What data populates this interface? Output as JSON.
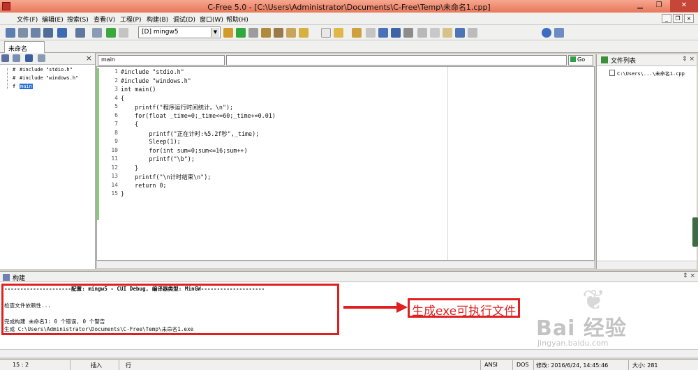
{
  "window": {
    "title": "C-Free 5.0 - [C:\\Users\\Administrator\\Documents\\C-Free\\Temp\\未命名1.cpp]",
    "controls": {
      "minimize": "▁",
      "maximize": "❐",
      "close": "✕"
    }
  },
  "menubar": {
    "items": [
      "文件(F)",
      "编辑(E)",
      "搜索(S)",
      "查看(V)",
      "工程(P)",
      "构建(B)",
      "调试(D)",
      "窗口(W)",
      "帮助(H)"
    ],
    "mdi_controls": {
      "minimize": "_",
      "restore": "❐",
      "close": "×"
    }
  },
  "toolbar": {
    "configuration": "[D] mingw5",
    "icons": [
      "find-icon",
      "replace-icon",
      "find-in-files-icon",
      "bookmark-icon",
      "tools-icon",
      "code-icon",
      "back-icon",
      "forward-icon",
      "compile-icon",
      "run-icon",
      "stop-icon",
      "build-icon",
      "rebuild-icon",
      "debug-icon",
      "new-file-icon",
      "open-file-icon",
      "open-project-icon",
      "save-icon",
      "save-all-icon",
      "print-icon",
      "cut-icon",
      "copy-icon",
      "paste-icon",
      "undo-icon",
      "redo-icon",
      "help-icon"
    ]
  },
  "tabs": [
    {
      "label": "未命名1.cpp",
      "active": true
    }
  ],
  "symbol_panel": {
    "close": "×",
    "items": [
      {
        "icon": "#",
        "label": "#include \"stdio.h\""
      },
      {
        "icon": "#",
        "label": "#include \"windows.h\""
      },
      {
        "icon": "f",
        "label": "main",
        "selected": true
      }
    ]
  },
  "editor": {
    "symbol_select": "main",
    "go_label": "Go",
    "lines": [
      "#include \"stdio.h\"",
      "#include \"windows.h\"",
      "int main()",
      "{",
      "    printf(\"程序运行时间统计。\\n\");",
      "    for(float _time=0;_time<=60;_time+=0.01)",
      "    {",
      "        printf(\"正在计时:%5.2f秒\",_time);",
      "        Sleep(1);",
      "        for(int sum=0;sum<=16;sum++)",
      "        printf(\"\\b\");",
      "    }",
      "    printf(\"\\n计时结束\\n\");",
      "    return 0;",
      "}"
    ],
    "line_numbers": [
      "1",
      "2",
      "3",
      "4",
      "5",
      "6",
      "7",
      "8",
      "9",
      "10",
      "11",
      "12",
      "13",
      "14",
      "15"
    ]
  },
  "file_list": {
    "title": "文件列表",
    "pins": "⇕ ×",
    "files": [
      "C:\\Users\\...\\未命名1.cpp"
    ]
  },
  "build_panel": {
    "title": "构建",
    "pins": "⇕ ×",
    "lines": [
      "---------------------配置: mingw5 - CUI Debug, 编译器类型: MinGW--------------------",
      "",
      "检查文件依赖性...",
      "",
      "完成构建 未命名1: 0 个错误, 0 个警告",
      "生成 C:\\Users\\Administrator\\Documents\\C-Free\\Temp\\未命名1.exe"
    ],
    "annotation": "生成exe可执行文件"
  },
  "watermark": {
    "brand": "Bai 经验",
    "url": "jingyan.baidu.com"
  },
  "statusbar": {
    "position": "15 : 2",
    "mode": "插入",
    "unit": "行",
    "encoding": "ANSI",
    "line_ending": "DOS",
    "modified": "修改: 2016/6/24, 14:45:46",
    "size": "大小: 281"
  },
  "colors": {
    "annotation": "#e02020",
    "titlebar": "#e8775a",
    "changebar": "#7ed36a",
    "selection": "#2a6fd6"
  }
}
